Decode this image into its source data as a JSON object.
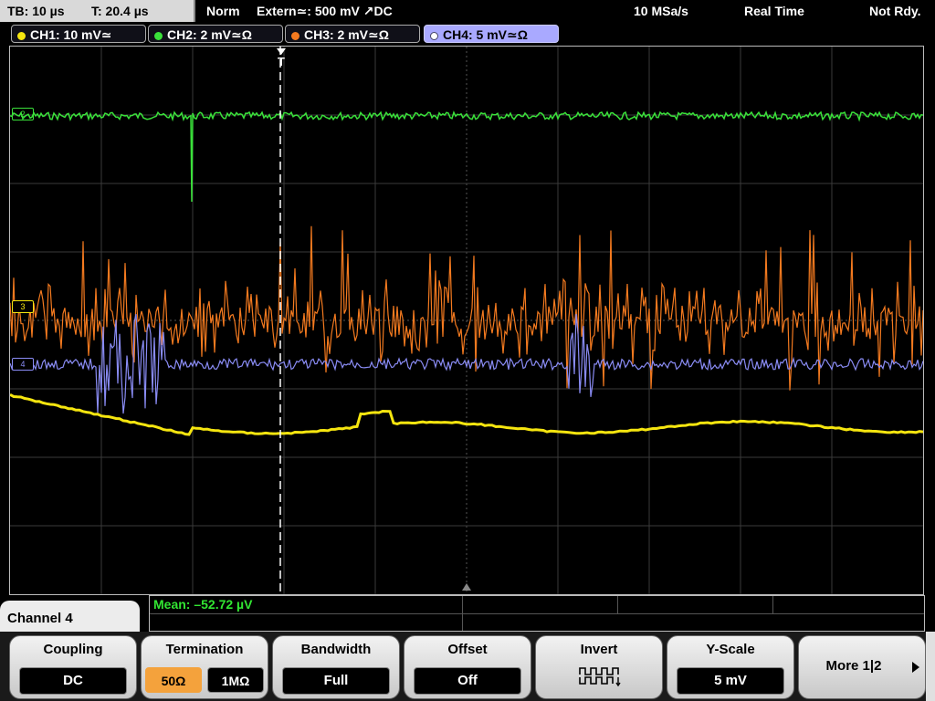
{
  "top": {
    "timebase": "TB: 10 µs",
    "trigger_time": "T: 20.4 µs",
    "mode": "Norm",
    "trigger_source": "Extern≃: 500 mV ↗DC",
    "sample_rate": "10 MSa/s",
    "acq_mode": "Real Time",
    "status": "Not Rdy."
  },
  "channels": [
    {
      "label": "CH1: 10 mV≃",
      "color": "#f5e50f"
    },
    {
      "label": "CH2: 2 mV≃Ω",
      "color": "#3ae13a"
    },
    {
      "label": "CH3: 2 mV≃Ω",
      "color": "#f47a1f"
    },
    {
      "label": "CH4: 5 mV≃Ω",
      "color": "#8a8cf5",
      "active": true
    }
  ],
  "markers": {
    "ch2": "2",
    "ch3": "3",
    "ch4": "4",
    "trigger": "T"
  },
  "measurement": {
    "mean": "Mean: –52.72 µV"
  },
  "panel": {
    "title": "Channel 4",
    "coupling_label": "Coupling",
    "coupling_value": "DC",
    "termination_label": "Termination",
    "termination_50": "50Ω",
    "termination_1m": "1MΩ",
    "bandwidth_label": "Bandwidth",
    "bandwidth_value": "Full",
    "offset_label": "Offset",
    "offset_value": "Off",
    "invert_label": "Invert",
    "yscale_label": "Y-Scale",
    "yscale_value": "5 mV",
    "more_label": "More 1|2"
  }
}
